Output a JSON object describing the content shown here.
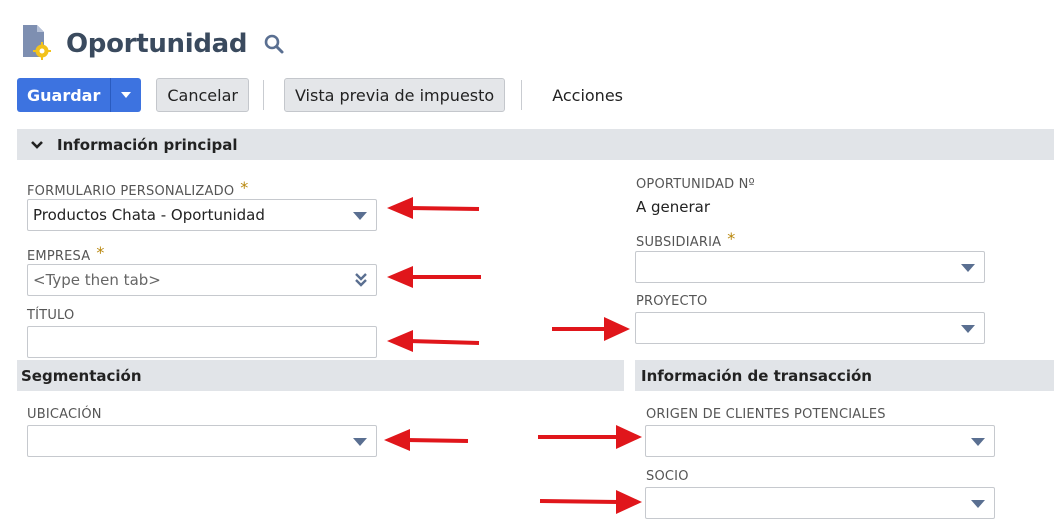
{
  "header": {
    "title": "Oportunidad",
    "page_icon": "document-gear-icon",
    "search_icon": "search-icon"
  },
  "toolbar": {
    "save_label": "Guardar",
    "cancel_label": "Cancelar",
    "tax_preview_label": "Vista previa de impuesto",
    "actions_label": "Acciones"
  },
  "sections": {
    "main": "Información principal",
    "segmentation": "Segmentación",
    "transaction": "Información de transacción"
  },
  "fields": {
    "custom_form": {
      "label": "FORMULARIO PERSONALIZADO",
      "required": "*",
      "value": "Productos Chata - Oportunidad"
    },
    "company": {
      "label": "EMPRESA",
      "required": "*",
      "placeholder": "<Type then tab>"
    },
    "title": {
      "label": "TÍTULO",
      "value": ""
    },
    "opportunity_no": {
      "label": "OPORTUNIDAD Nº",
      "value": "A generar"
    },
    "subsidiary": {
      "label": "SUBSIDIARIA",
      "required": "*",
      "value": ""
    },
    "project": {
      "label": "PROYECTO",
      "value": ""
    },
    "location": {
      "label": "UBICACIÓN",
      "value": ""
    },
    "lead_source": {
      "label": "ORIGEN DE CLIENTES POTENCIALES",
      "value": ""
    },
    "partner": {
      "label": "SOCIO",
      "value": ""
    }
  },
  "colors": {
    "primary": "#3d73e0",
    "annotation_arrow": "#e0161b",
    "section_bg": "#e1e4e8",
    "required_star": "#b8860b"
  }
}
